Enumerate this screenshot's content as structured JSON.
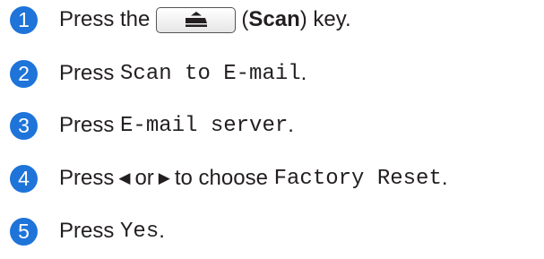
{
  "accent_color": "#1e74d9",
  "steps": [
    {
      "number": "1",
      "press": "Press the",
      "key_icon": "scan-key-icon",
      "open_paren": "(",
      "key_name": "Scan",
      "close_text": ") key."
    },
    {
      "number": "2",
      "press": "Press",
      "option": "Scan to E-mail",
      "end": "."
    },
    {
      "number": "3",
      "press": "Press",
      "option": "E-mail server",
      "end": "."
    },
    {
      "number": "4",
      "press": "Press",
      "left_icon": "left-triangle-icon",
      "or": "or",
      "right_icon": "right-triangle-icon",
      "to_choose": "to choose",
      "option": "Factory Reset",
      "end": "."
    },
    {
      "number": "5",
      "press": "Press",
      "option": "Yes",
      "end": "."
    }
  ]
}
